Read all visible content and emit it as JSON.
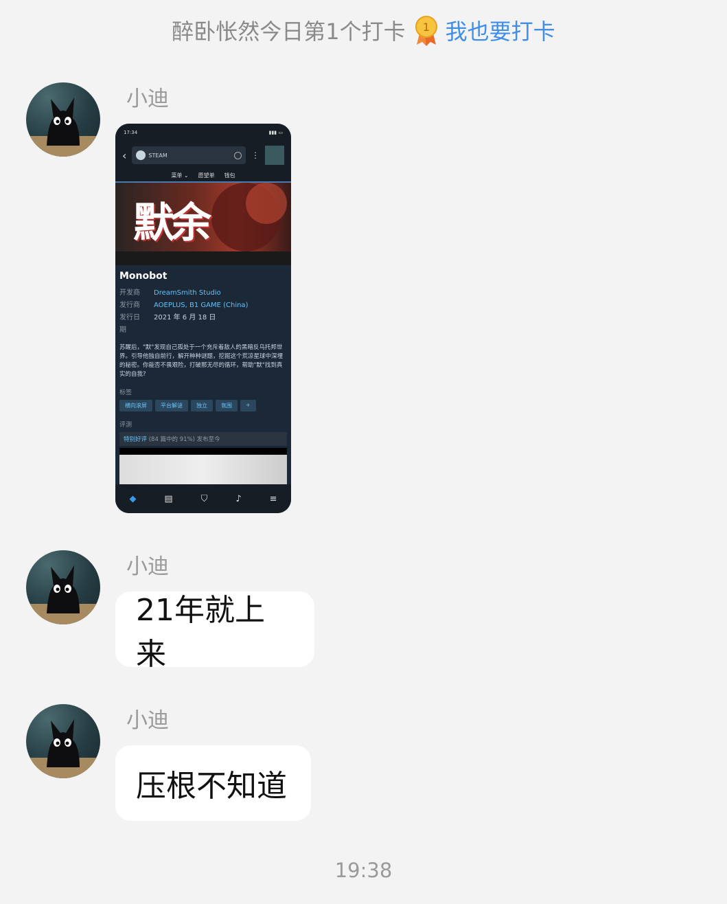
{
  "notice": {
    "text": "醉卧怅然今日第1个打卡",
    "medal_number": "1",
    "link": "我也要打卡"
  },
  "messages": [
    {
      "sender": "小迪",
      "type": "image"
    },
    {
      "sender": "小迪",
      "type": "text",
      "text": "21年就上来"
    },
    {
      "sender": "小迪",
      "type": "text",
      "text": "压根不知道"
    }
  ],
  "screenshot": {
    "status_time": "17:34",
    "search_label": "STEAM",
    "menu": [
      "菜单 ⌄",
      "愿望单",
      "钱包"
    ],
    "hero_title": "默余",
    "game_name": "Monobot",
    "developer_key": "开发商",
    "developer": "DreamSmith Studio",
    "publisher_key": "发行商",
    "publisher": "AOEPLUS, B1 GAME (China)",
    "release_key": "发行日期",
    "release": "2021 年 6 月 18 日",
    "description": "苏醒后，\"默\"发现自己孤处于一个充斥着敌人的黑暗反乌托邦世界。引导他独自前行，解开种种谜题，挖掘这个荒凉星球中深埋的秘密。你能否不畏艰险，打破那无尽的循环，帮助\"默\"找到真实的自我?",
    "tags_label": "标签",
    "tags": [
      "横向滚屏",
      "平台解谜",
      "独立",
      "氛围",
      "+"
    ],
    "review_label": "评测",
    "review_positive": "特别好评",
    "review_rest": " (84 篇中的 91%) 发布至今"
  },
  "timestamp": "19:38",
  "colors": {
    "link": "#3f8ee8",
    "background": "#f3f3f3",
    "steam_blue": "#67c1f5"
  },
  "icons": [
    "medal-icon",
    "back-chevron-icon",
    "steam-logo-icon",
    "search-icon",
    "more-icon",
    "tag-icon",
    "news-icon",
    "shield-icon",
    "bell-icon",
    "menu-icon"
  ]
}
